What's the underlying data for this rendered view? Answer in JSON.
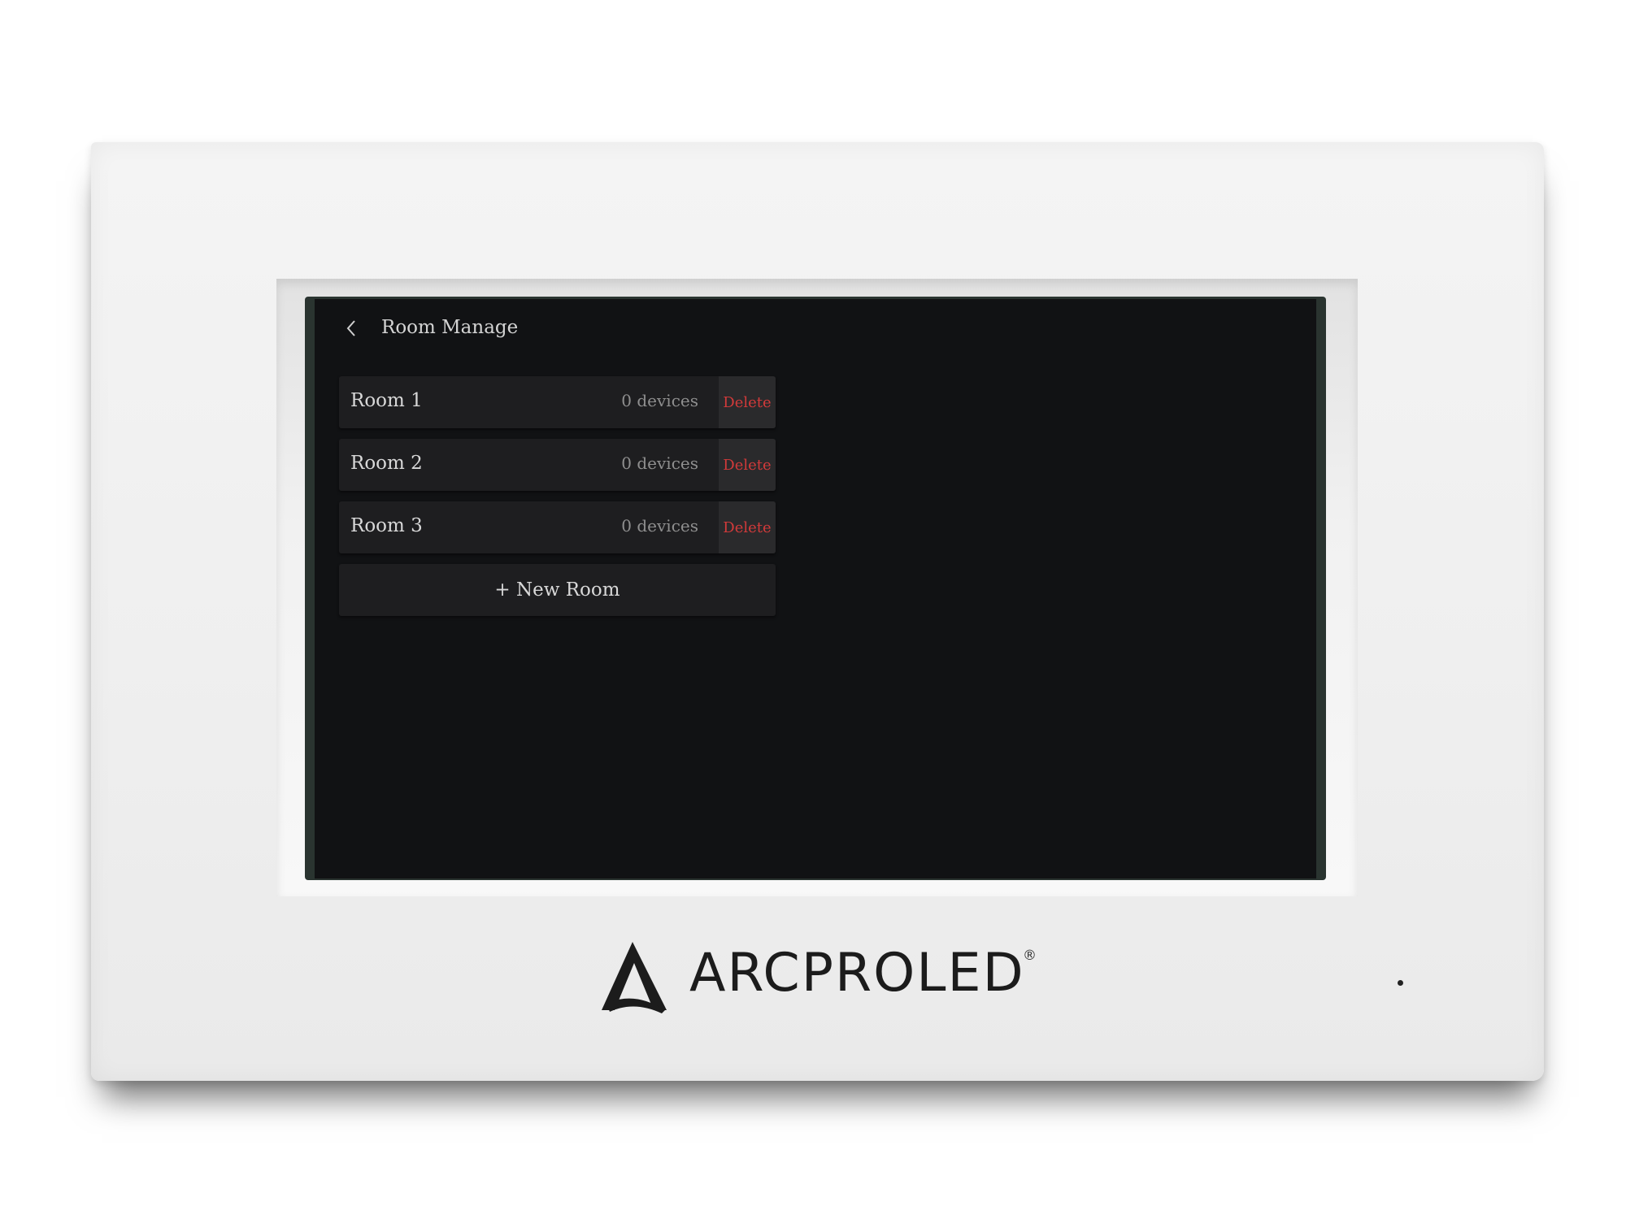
{
  "header": {
    "title": "Room Manage",
    "back_icon": "chevron-left-icon"
  },
  "rooms": [
    {
      "name": "Room 1",
      "devices": "0 devices",
      "delete_label": "Delete"
    },
    {
      "name": "Room 2",
      "devices": "0 devices",
      "delete_label": "Delete"
    },
    {
      "name": "Room 3",
      "devices": "0 devices",
      "delete_label": "Delete"
    }
  ],
  "new_room_label": "+ New Room",
  "brand": {
    "name": "ARCPROLED",
    "registered": "®"
  },
  "colors": {
    "screen_bg": "#111214",
    "row_bg": "#1e1e20",
    "delete_text": "#d23a3a",
    "device_body": "#efefef"
  }
}
